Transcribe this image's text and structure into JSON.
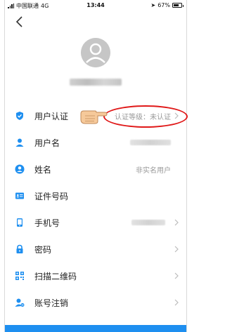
{
  "status_bar": {
    "carrier": "中国联通",
    "network": "4G",
    "time": "13:44",
    "battery": "67%",
    "battery_level": 0.67
  },
  "rows": [
    {
      "label": "用户认证",
      "value": "认证等级：未认证",
      "icon": "shield-check-icon"
    },
    {
      "label": "用户名",
      "icon": "person-icon"
    },
    {
      "label": "姓名",
      "value": "非实名用户",
      "icon": "person-circle-icon"
    },
    {
      "label": "证件号码",
      "icon": "id-card-icon"
    },
    {
      "label": "手机号",
      "icon": "phone-icon"
    },
    {
      "label": "密码",
      "icon": "lock-icon"
    },
    {
      "label": "扫描二维码",
      "icon": "qr-code-icon"
    },
    {
      "label": "账号注销",
      "icon": "person-remove-icon"
    }
  ],
  "colors": {
    "accent": "#1e8ff0",
    "highlight": "#e01818"
  }
}
